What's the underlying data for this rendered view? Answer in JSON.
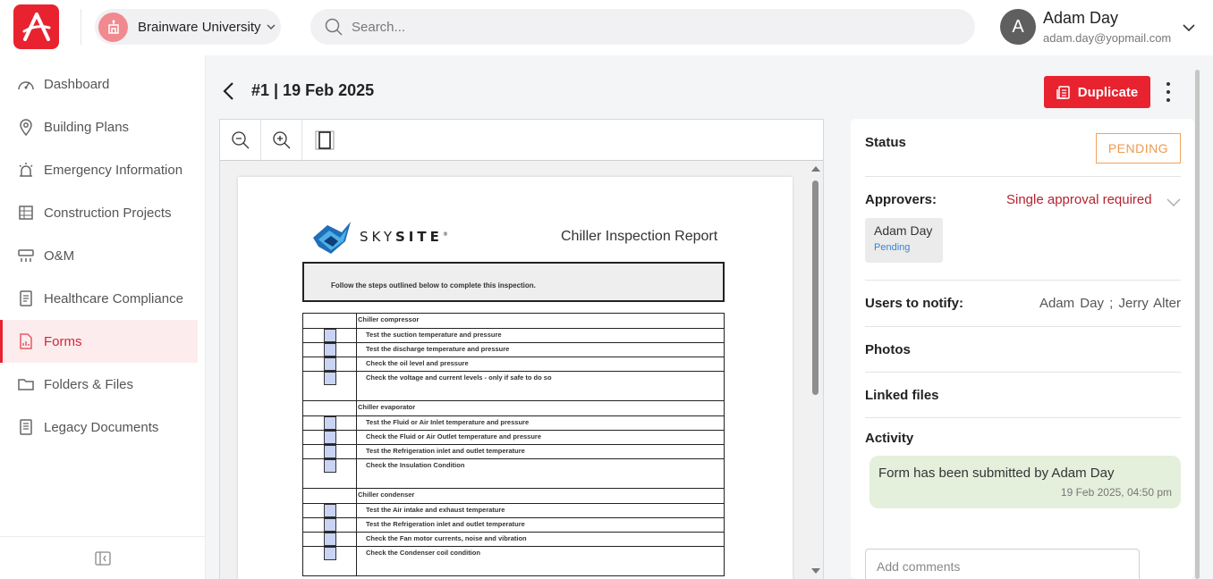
{
  "header": {
    "org_name": "Brainware University",
    "search_placeholder": "Search...",
    "user": {
      "initial": "A",
      "name": "Adam Day",
      "email": "adam.day@yopmail.com"
    }
  },
  "sidebar": {
    "items": [
      {
        "label": "Dashboard",
        "icon": "dashboard-icon"
      },
      {
        "label": "Building Plans",
        "icon": "location-pin-icon"
      },
      {
        "label": "Emergency Information",
        "icon": "siren-icon"
      },
      {
        "label": "Construction Projects",
        "icon": "construction-icon"
      },
      {
        "label": "O&M",
        "icon": "maintenance-icon"
      },
      {
        "label": "Healthcare Compliance",
        "icon": "compliance-icon"
      },
      {
        "label": "Forms",
        "icon": "forms-icon",
        "active": true
      },
      {
        "label": "Folders & Files",
        "icon": "folder-icon"
      },
      {
        "label": "Legacy Documents",
        "icon": "documents-icon"
      }
    ]
  },
  "page": {
    "title": "#1 | 19 Feb 2025",
    "duplicate_label": "Duplicate"
  },
  "document": {
    "brand_light": "SKY",
    "brand_bold": "SITE",
    "trademark": "®",
    "report_title": "Chiller Inspection Report",
    "instructions": "Follow the steps outlined below to complete this inspection.",
    "sections": [
      {
        "heading": "Chiller compressor",
        "items": [
          "Test the suction temperature and pressure",
          "Test the discharge temperature and pressure",
          "Check the oil level and pressure",
          "Check the voltage and current levels - only if safe to do so"
        ]
      },
      {
        "heading": "Chiller evaporator",
        "items": [
          "Test the Fluid or Air Inlet temperature and pressure",
          "Check the Fluid or Air Outlet temperature and pressure",
          "Test the Refrigeration inlet and outlet temperature",
          "Check the Insulation Condition"
        ]
      },
      {
        "heading": "Chiller condenser",
        "items": [
          "Test the Air intake and exhaust temperature",
          "Test the Refrigeration inlet and outlet temperature",
          "Check the Fan motor currents, noise and vibration",
          "Check the Condenser coil condition"
        ]
      }
    ]
  },
  "panel": {
    "status_label": "Status",
    "status_value": "PENDING",
    "approvers_label": "Approvers:",
    "approval_requirement": "Single approval required",
    "approver": {
      "name": "Adam Day",
      "status": "Pending"
    },
    "notify_label": "Users to notify:",
    "notify_users": "Adam Day ;   Jerry Alter",
    "photos_label": "Photos",
    "linked_files_label": "Linked files",
    "activity_label": "Activity",
    "activity": {
      "text": "Form has been submitted by Adam Day",
      "time": "19 Feb 2025, 04:50 pm"
    },
    "comment_placeholder": "Add comments"
  },
  "colors": {
    "brand_red": "#e8232f",
    "pending_orange": "#ee9a4f",
    "activity_green": "#e4efdc"
  }
}
